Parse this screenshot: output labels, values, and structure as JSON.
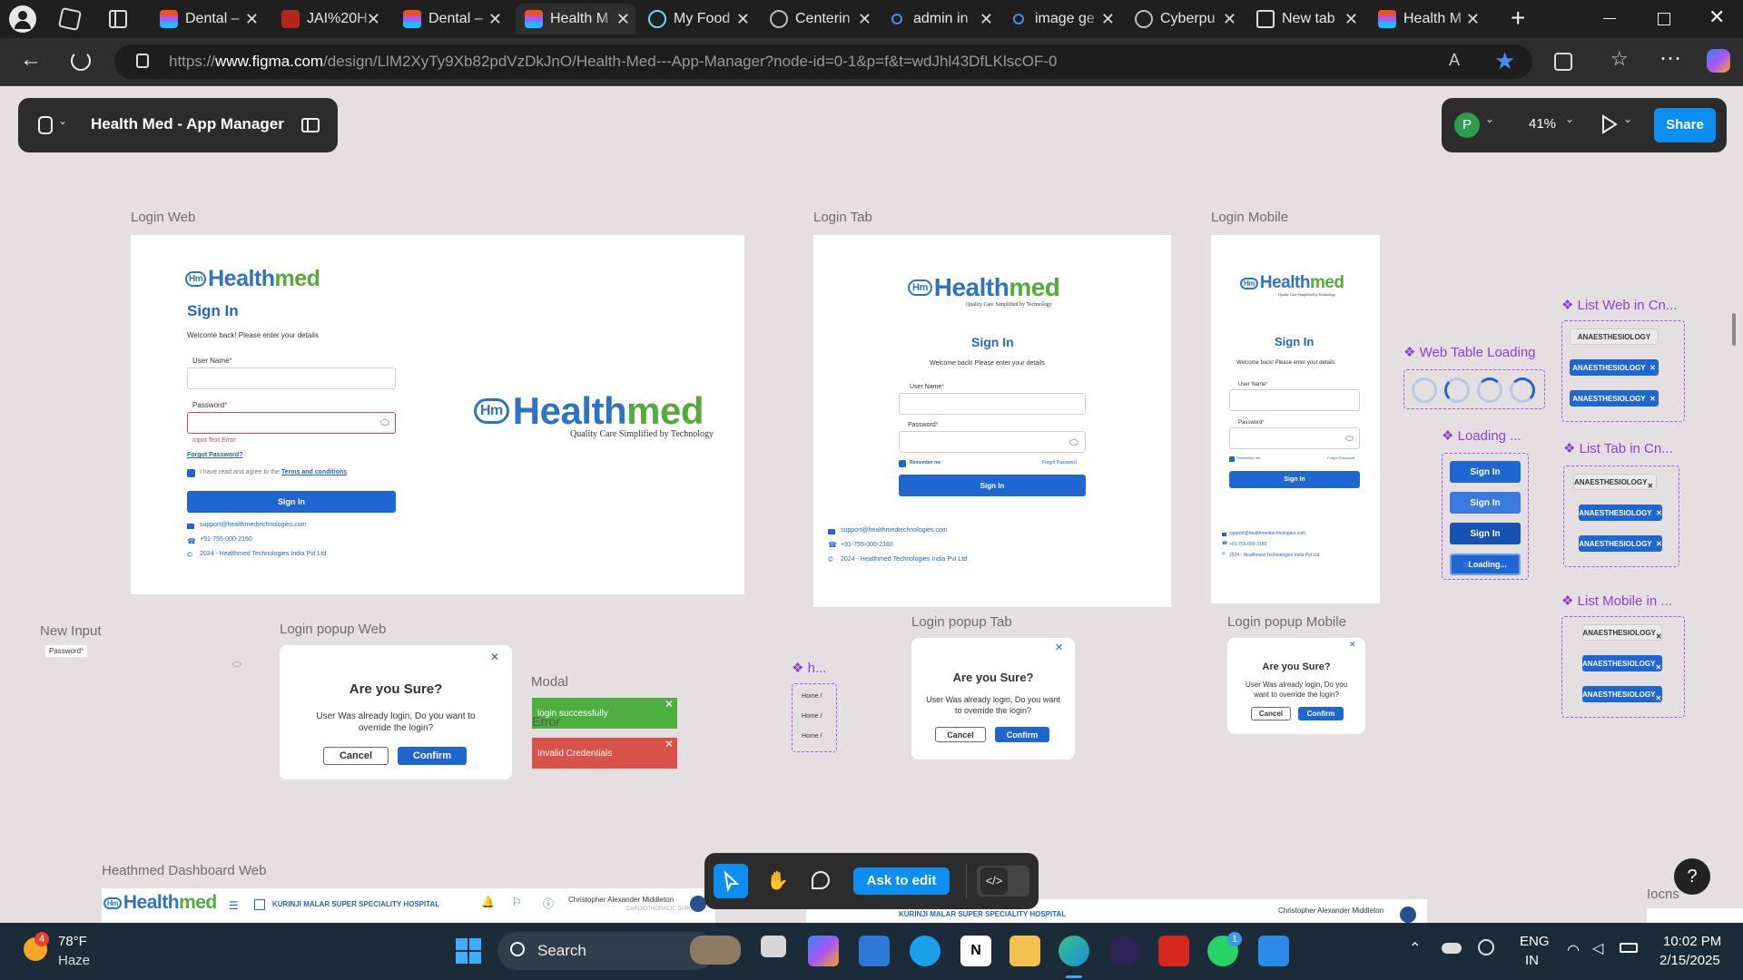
{
  "browser": {
    "tabs": [
      {
        "title": "Dental –",
        "icon": "figma-icon"
      },
      {
        "title": "JAI%20H",
        "icon": "pdf-icon"
      },
      {
        "title": "Dental –",
        "icon": "figma-icon"
      },
      {
        "title": "Health M",
        "icon": "figma-icon",
        "active": true
      },
      {
        "title": "My Food",
        "icon": "react-icon"
      },
      {
        "title": "Centerin",
        "icon": "openai-icon"
      },
      {
        "title": "admin in",
        "icon": "search-icon"
      },
      {
        "title": "image ge",
        "icon": "search-icon"
      },
      {
        "title": "Cyberpu",
        "icon": "openai-icon"
      },
      {
        "title": "New tab",
        "icon": "newtab-icon"
      },
      {
        "title": "Health M",
        "icon": "figma-icon"
      }
    ],
    "url_prefix": "https://",
    "url_host": "www.figma.com",
    "url_path": "/design/LlM2XyTy9Xb82pdVzDkJnO/Health-Med---App-Manager?node-id=0-1&p=f&t=wdJhl43DfLKlscOF-0"
  },
  "figma": {
    "file_title": "Health Med - App Manager",
    "avatar_letter": "P",
    "zoom": "41%",
    "share_label": "Share",
    "ask_to_edit_label": "Ask to edit",
    "help_label": "?"
  },
  "frames": {
    "login_web": "Login Web",
    "login_tab": "Login Tab",
    "login_mobile": "Login Mobile",
    "new_input": "New Input",
    "login_popup_web": "Login popup Web",
    "modal": "Modal",
    "login_popup_tab": "Login popup Tab",
    "login_popup_mobile": "Login popup Mobile",
    "dashboard_web": "Heathmed Dashboard Web",
    "icons": "Iocns"
  },
  "brand": {
    "logo_h": "Health",
    "logo_m": "med",
    "logo_badge": "Hm",
    "tagline": "Quality Care Simplified by Technology"
  },
  "login": {
    "title": "Sign In",
    "welcome": "Welcome back! Please enter your details",
    "username_label": "User Name",
    "password_label": "Password",
    "required_mark": "*",
    "error_text": "Input Text Error",
    "forgot": "Forgot Password?",
    "forgot_tab": "Forgot Password",
    "terms_prefix": "I have read and agree to the",
    "terms_link": "Terms and conditions",
    "remember": "Remember me",
    "signin_button": "Sign In",
    "email": "support@healthmedtechnologies.com",
    "phone": "+91-755-000-2160",
    "copyright": "2024 - Healthmed Technologies India Pvt Ltd"
  },
  "components": {
    "web_table_loading": "Web Table Loading",
    "loading": "Loading ...",
    "loading_button": "Loading...",
    "list_web": "List Web in Cn...",
    "list_tab": "List Tab in Cn...",
    "list_mobile": "List Mobile in ...",
    "chip_text": "ANAESTHESIOLOGY",
    "breadcrumb_comp": "h...",
    "breadcrumb_items": [
      "Home /",
      "Home /",
      "Home /"
    ],
    "new_input_label": "Password",
    "error_label": "Error"
  },
  "popup": {
    "title": "Are you Sure?",
    "message": "User Was already login, Do you want to override the login?",
    "cancel": "Cancel",
    "confirm": "Confirm"
  },
  "toasts": {
    "success": "login successfully",
    "error": "Invalid Credentials",
    "success_color": "#4caf3f",
    "error_color": "#d9534a"
  },
  "dashboard": {
    "hospital": "KURINJI MALAR SUPER SPECIALITY HOSPITAL",
    "user": "Christopher Alexander Middleton",
    "dept": "CARDIOTHORACIC SURGERY",
    "nav": [
      "Notifications",
      "English",
      "App Info"
    ]
  },
  "taskbar": {
    "weather_temp": "78°F",
    "weather_desc": "Haze",
    "weather_badge": "4",
    "search": "Search",
    "lang1": "ENG",
    "lang2": "IN",
    "time": "10:02 PM",
    "date": "2/15/2025",
    "whatsapp_badge": "1"
  },
  "colors": {
    "canvas": "#e6dfe1",
    "brand_blue": "#1f66d1",
    "brand_green": "#55aa3b",
    "component_purple": "#8b3fd8",
    "figma_share": "#0d8ef0"
  }
}
